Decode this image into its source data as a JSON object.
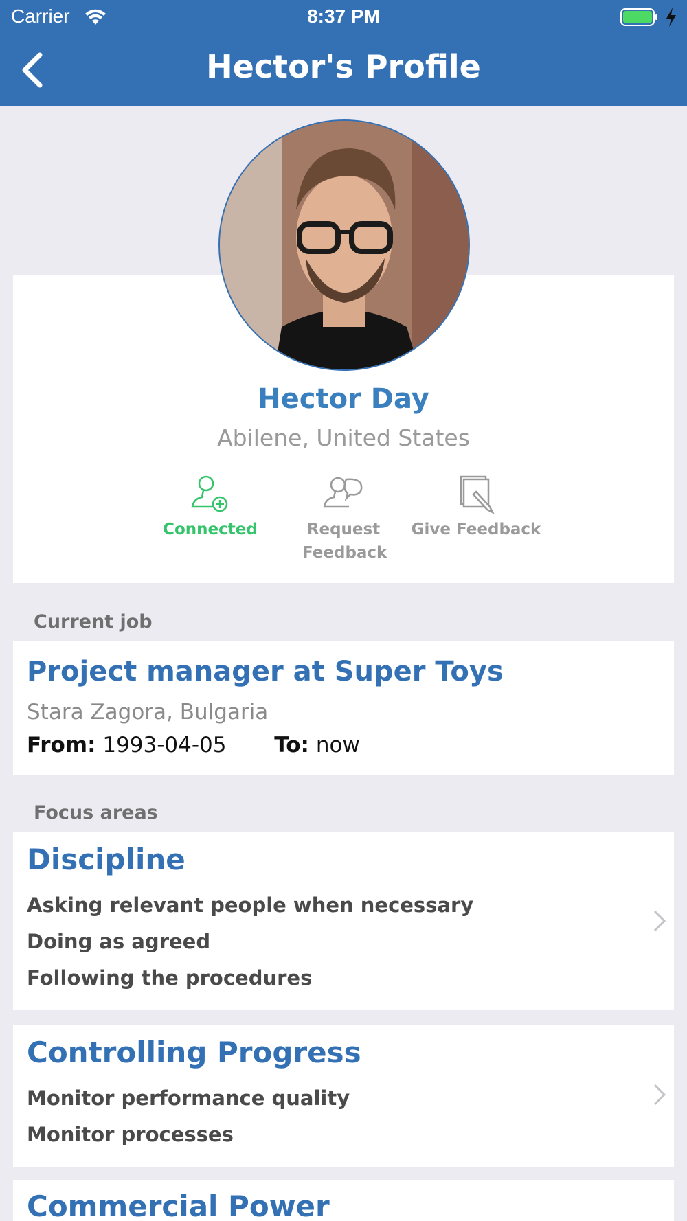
{
  "status_bar": {
    "carrier": "Carrier",
    "time": "8:37 PM"
  },
  "nav": {
    "title": "Hector's Profile"
  },
  "profile": {
    "name": "Hector Day",
    "location": "Abilene, United States",
    "actions": [
      {
        "label": "Connected",
        "icon": "add-person-icon"
      },
      {
        "label": "Request Feedback",
        "icon": "request-feedback-icon"
      },
      {
        "label": "Give Feedback",
        "icon": "give-feedback-icon"
      }
    ]
  },
  "current_job": {
    "section_label": "Current job",
    "title": "Project manager at Super Toys",
    "location": "Stara Zagora, Bulgaria",
    "from_label": "From:",
    "from_value": "1993-04-05",
    "to_label": "To:",
    "to_value": "now"
  },
  "focus_areas": {
    "section_label": "Focus areas",
    "groups": [
      {
        "title": "Discipline",
        "items": [
          "Asking relevant people when necessary",
          "Doing as agreed",
          "Following the procedures"
        ]
      },
      {
        "title": "Controlling Progress",
        "items": [
          "Monitor performance quality",
          "Monitor processes"
        ]
      },
      {
        "title": "Commercial Power",
        "items": []
      }
    ]
  },
  "colors": {
    "accent": "#3471b4",
    "connected": "#35c46c",
    "background": "#ecebf1"
  }
}
